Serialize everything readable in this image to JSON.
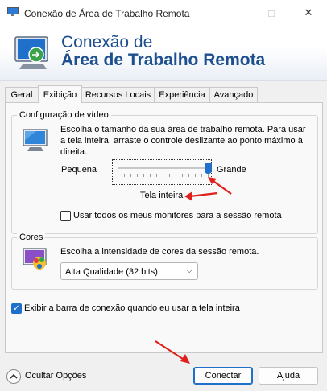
{
  "window": {
    "title": "Conexão de Área de Trabalho Remota",
    "minimize_icon": "minimize-icon",
    "maximize_icon": "maximize-icon",
    "close_icon": "close-icon"
  },
  "banner": {
    "line1": "Conexão de",
    "line2": "Área de Trabalho Remota"
  },
  "tabs": [
    {
      "label": "Geral",
      "active": false
    },
    {
      "label": "Exibição",
      "active": true
    },
    {
      "label": "Recursos Locais",
      "active": false
    },
    {
      "label": "Experiência",
      "active": false
    },
    {
      "label": "Avançado",
      "active": false
    }
  ],
  "display_config": {
    "group_label": "Configuração de vídeo",
    "description": "Escolha o tamanho da sua área de trabalho remota. Para usar a tela inteira, arraste o controle deslizante ao ponto máximo à direita.",
    "slider_min_label": "Pequena",
    "slider_max_label": "Grande",
    "slider_value": 1.0,
    "slider_value_label": "Tela inteira",
    "all_monitors_checkbox": {
      "label": "Usar todos os meus monitores para a sessão remota",
      "checked": false
    }
  },
  "colors": {
    "group_label": "Cores",
    "description": "Escolha a intensidade de cores da sessão remota.",
    "select_value": "Alta Qualidade (32 bits)"
  },
  "connection_bar_checkbox": {
    "label": "Exibir a barra de conexão quando eu usar a tela inteira",
    "checked": true
  },
  "footer": {
    "hide_options": "Ocultar Opções",
    "connect": "Conectar",
    "help": "Ajuda"
  },
  "accent_color": "#1f6fcb",
  "annotation_color": "#e0201c"
}
